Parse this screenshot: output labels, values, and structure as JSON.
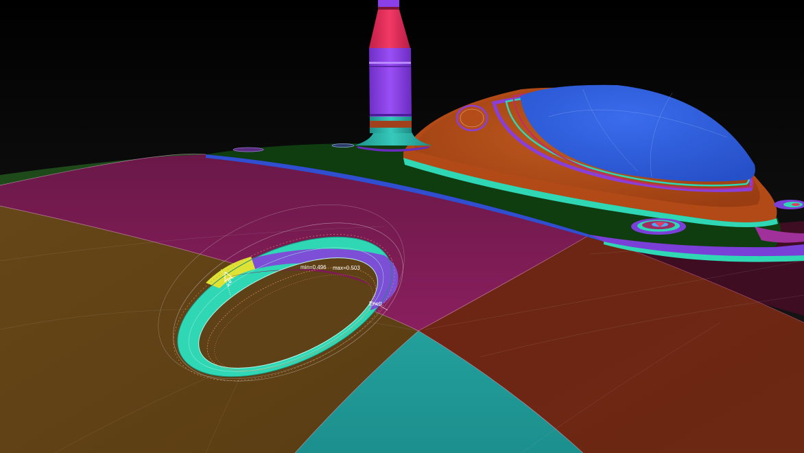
{
  "viewport": {
    "readouts": {
      "min": "min=0.496",
      "max": "max=0.503",
      "marker": "Enett"
    }
  },
  "colors": {
    "background": "#000000",
    "panel_magenta": "#7e1a56",
    "panel_ochre": "#5e4116",
    "panel_teal": "#1f9896",
    "panel_rust": "#6b2613",
    "panel_dark_maroon": "#3e0d22",
    "band_green": "#0f3d10",
    "dome_blue": "#2f5fdc",
    "dome_orange": "#b04a17",
    "stack_red": "#e4305a",
    "stack_purple": "#8b3fe8",
    "ring_teal": "#2fd7b5",
    "ring_purple": "#7d4fd6",
    "ring_yellow": "#dde234",
    "guide_orange": "#e69060",
    "guide_white": "#d8d8d8"
  },
  "icons": {
    "cursor": "manipulator-arrow-icon"
  }
}
